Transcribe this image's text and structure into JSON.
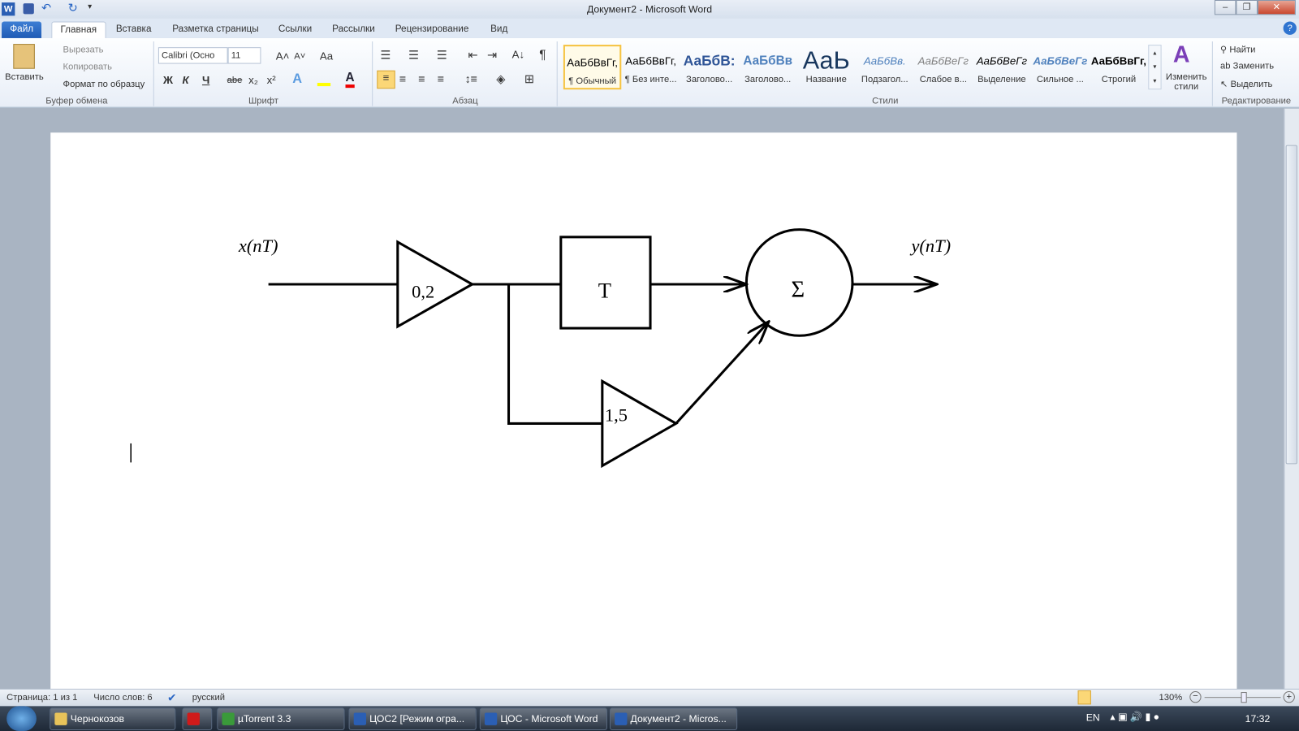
{
  "window": {
    "title": "Документ2 - Microsoft Word",
    "controls": [
      "–",
      "❐",
      "✕"
    ]
  },
  "quick_access": {
    "icons": [
      "word-icon",
      "save-icon",
      "undo-icon",
      "redo-icon",
      "customize-icon"
    ]
  },
  "tabs": [
    {
      "label": "Файл"
    },
    {
      "label": "Главная"
    },
    {
      "label": "Вставка"
    },
    {
      "label": "Разметка страницы"
    },
    {
      "label": "Ссылки"
    },
    {
      "label": "Рассылки"
    },
    {
      "label": "Рецензирование"
    },
    {
      "label": "Вид"
    }
  ],
  "ribbon": {
    "clipboard": {
      "label": "Буфер обмена",
      "paste": "Вставить",
      "cut": "Вырезать",
      "copy": "Копировать",
      "format_painter": "Формат по образцу"
    },
    "font": {
      "label": "Шрифт",
      "font_name": "Calibri (Осно",
      "font_size": "11",
      "bold": "Ж",
      "italic": "К",
      "underline": "Ч",
      "strike": "abe",
      "sub": "x₂",
      "sup": "x²",
      "grow": "A˄",
      "shrink": "A˅",
      "case": "Aa"
    },
    "paragraph": {
      "label": "Абзац",
      "pilcrow": "¶"
    },
    "styles": {
      "label": "Стили",
      "items": [
        {
          "sample": "АаБбВвГг,",
          "name": "¶ Обычный",
          "selected": true
        },
        {
          "sample": "АаБбВвГг,",
          "name": "¶ Без инте..."
        },
        {
          "sample": "АаБбВ:",
          "name": "Заголово..."
        },
        {
          "sample": "АаБбВв",
          "name": "Заголово..."
        },
        {
          "sample": "АаЬ",
          "name": "Название"
        },
        {
          "sample": "АаБбВв.",
          "name": "Подзагол..."
        },
        {
          "sample": "АаБбВеГг",
          "name": "Слабое в..."
        },
        {
          "sample": "АаБбВеГг",
          "name": "Выделение"
        },
        {
          "sample": "АаБбВеГг",
          "name": "Сильное ..."
        },
        {
          "sample": "АаБбВвГг,",
          "name": "Строгий"
        }
      ],
      "change_styles": "Изменить стили"
    },
    "editing": {
      "label": "Редактирование",
      "find": "Найти",
      "replace": "Заменить",
      "select": "Выделить"
    }
  },
  "diagram": {
    "input_label": "x(nT)",
    "output_label": "y(nT)",
    "gain1": "0,2",
    "delay": "T",
    "gain2": "1,5",
    "sum": "Σ"
  },
  "status": {
    "page": "Страница: 1 из 1",
    "words": "Число слов: 6",
    "language": "русский",
    "zoom": "130%"
  },
  "taskbar": {
    "items": [
      "Чернокозов",
      "",
      "µTorrent 3.3",
      "ЦОС2 [Режим огра...",
      "ЦОС - Microsoft Word",
      "Документ2 - Micros..."
    ],
    "lang": "EN",
    "time": "17:32"
  }
}
